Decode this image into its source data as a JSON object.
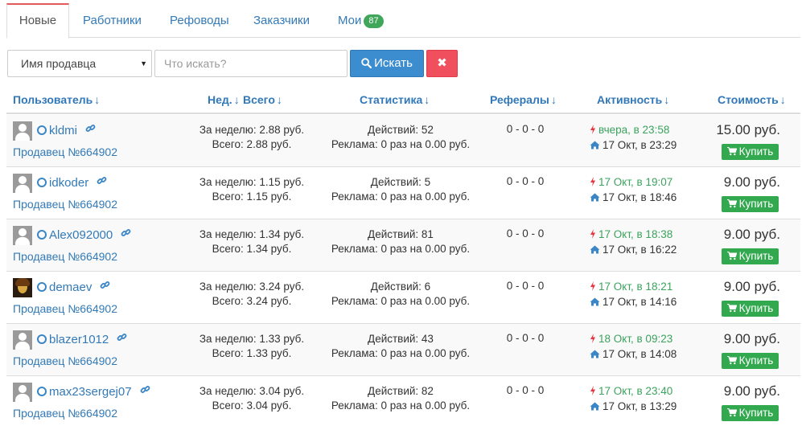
{
  "tabs": [
    {
      "label": "Новые",
      "active": true
    },
    {
      "label": "Работники"
    },
    {
      "label": "Рефоводы"
    },
    {
      "label": "Заказчики"
    },
    {
      "label": "Мои",
      "badge": "87"
    }
  ],
  "filter": {
    "select_value": "Имя продавца",
    "search_placeholder": "Что искать?",
    "search_button": "Искать",
    "clear_button": "✖"
  },
  "table": {
    "headers": {
      "user": "Пользователь",
      "week": "Нед.",
      "total": "Всего",
      "stats": "Статистика",
      "referrals": "Рефералы",
      "activity": "Активность",
      "price": "Стоимость"
    },
    "sort_arrow": "↓",
    "buy_label": "Купить",
    "rows": [
      {
        "username": "kldmi",
        "avatar": "placeholder",
        "seller": "Продавец №664902",
        "week": "За неделю: 2.88 руб.",
        "total": "Всего: 2.88 руб.",
        "actions": "Действий: 52",
        "ads": "Реклама: 0 раз на 0.00 руб.",
        "refs": "0 - 0 - 0",
        "last_action": "вчера, в 23:58",
        "last_visit": "17 Окт, в 23:29",
        "price": "15.00 руб."
      },
      {
        "username": "idkoder",
        "avatar": "placeholder",
        "seller": "Продавец №664902",
        "week": "За неделю: 1.15 руб.",
        "total": "Всего: 1.15 руб.",
        "actions": "Действий: 5",
        "ads": "Реклама: 0 раз на 0.00 руб.",
        "refs": "0 - 0 - 0",
        "last_action": "17 Окт, в 19:07",
        "last_visit": "17 Окт, в 18:46",
        "price": "9.00 руб."
      },
      {
        "username": "Alex092000",
        "avatar": "placeholder",
        "seller": "Продавец №664902",
        "week": "За неделю: 1.34 руб.",
        "total": "Всего: 1.34 руб.",
        "actions": "Действий: 81",
        "ads": "Реклама: 0 раз на 0.00 руб.",
        "refs": "0 - 0 - 0",
        "last_action": "17 Окт, в 18:38",
        "last_visit": "17 Окт, в 16:22",
        "price": "9.00 руб."
      },
      {
        "username": "demaev",
        "avatar": "photo",
        "seller": "Продавец №664902",
        "week": "За неделю: 3.24 руб.",
        "total": "Всего: 3.24 руб.",
        "actions": "Действий: 6",
        "ads": "Реклама: 0 раз на 0.00 руб.",
        "refs": "0 - 0 - 0",
        "last_action": "17 Окт, в 18:21",
        "last_visit": "17 Окт, в 14:16",
        "price": "9.00 руб."
      },
      {
        "username": "blazer1012",
        "avatar": "placeholder",
        "seller": "Продавец №664902",
        "week": "За неделю: 1.33 руб.",
        "total": "Всего: 1.33 руб.",
        "actions": "Действий: 43",
        "ads": "Реклама: 0 раз на 0.00 руб.",
        "refs": "0 - 0 - 0",
        "last_action": "18 Окт, в 09:23",
        "last_visit": "17 Окт, в 14:08",
        "price": "9.00 руб."
      },
      {
        "username": "max23sergej07",
        "avatar": "placeholder",
        "seller": "Продавец №664902",
        "week": "За неделю: 3.04 руб.",
        "total": "Всего: 3.04 руб.",
        "actions": "Действий: 82",
        "ads": "Реклама: 0 раз на 0.00 руб.",
        "refs": "0 - 0 - 0",
        "last_action": "17 Окт, в 23:40",
        "last_visit": "17 Окт, в 13:29",
        "price": "9.00 руб."
      }
    ]
  },
  "colors": {
    "accent": "#337ab7",
    "search_button": "#3c8dcf",
    "clear_button": "#f0505e",
    "buy_button": "#33a94f",
    "activity_recent": "#3aa35d",
    "bolt": "#e8343c"
  }
}
